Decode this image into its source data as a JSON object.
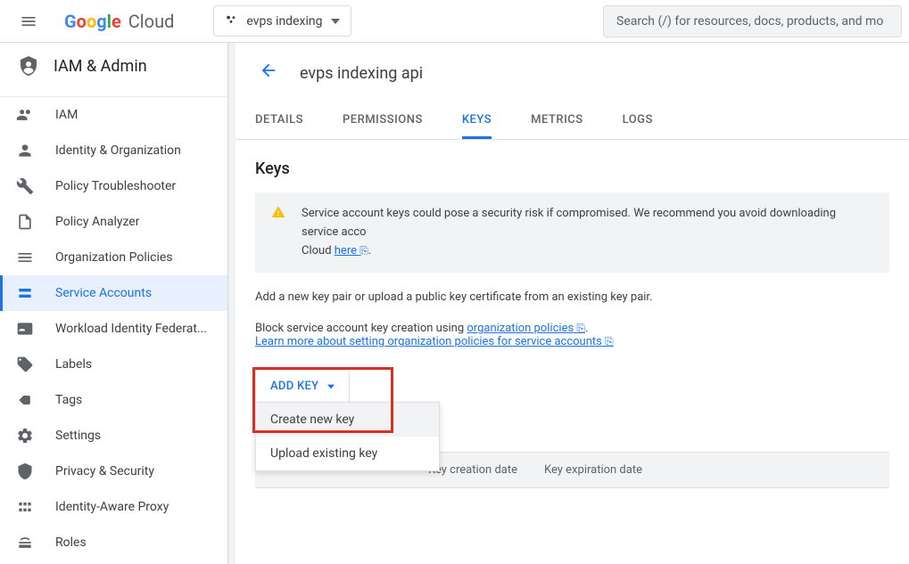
{
  "topbar": {
    "logo": "Google Cloud",
    "project": "evps indexing",
    "search_placeholder": "Search (/) for resources, docs, products, and mo"
  },
  "section": {
    "title": "IAM & Admin"
  },
  "nav": [
    {
      "label": "IAM"
    },
    {
      "label": "Identity & Organization"
    },
    {
      "label": "Policy Troubleshooter"
    },
    {
      "label": "Policy Analyzer"
    },
    {
      "label": "Organization Policies"
    },
    {
      "label": "Service Accounts"
    },
    {
      "label": "Workload Identity Federat..."
    },
    {
      "label": "Labels"
    },
    {
      "label": "Tags"
    },
    {
      "label": "Settings"
    },
    {
      "label": "Privacy & Security"
    },
    {
      "label": "Identity-Aware Proxy"
    },
    {
      "label": "Roles"
    }
  ],
  "content": {
    "title": "evps indexing api",
    "tabs": [
      {
        "label": "Details"
      },
      {
        "label": "Permissions"
      },
      {
        "label": "Keys"
      },
      {
        "label": "Metrics"
      },
      {
        "label": "Logs"
      }
    ],
    "section_title": "Keys",
    "warning": {
      "text_prefix": "Service account keys could pose a security risk if compromised. We recommend you avoid downloading service acco",
      "text_suffix": "Cloud ",
      "link": "here"
    },
    "desc": "Add a new key pair or upload a public key certificate from an existing key pair.",
    "block": {
      "line1_prefix": "Block service account key creation using ",
      "line1_link": "organization policies",
      "line2_link": "Learn more about setting organization policies for service accounts"
    },
    "addkey_label": "ADD KEY",
    "dropdown": [
      {
        "label": "Create new key"
      },
      {
        "label": "Upload existing key"
      }
    ],
    "table_headers": {
      "creation": "Key creation date",
      "expiration": "Key expiration date"
    }
  }
}
